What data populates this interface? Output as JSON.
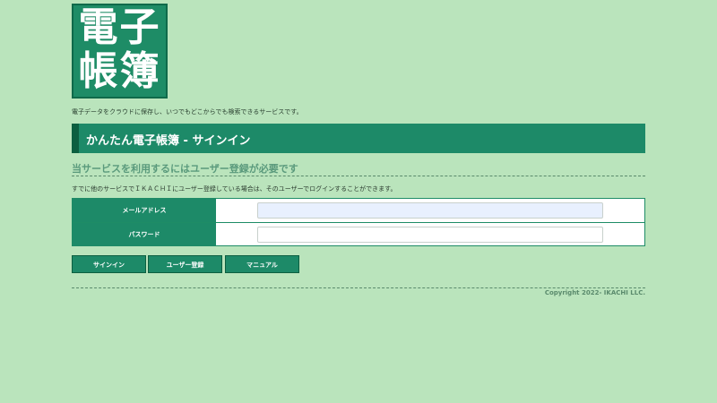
{
  "logo": {
    "line1": "電子",
    "line2": "帳簿"
  },
  "tagline": "電子データをクラウドに保存し、いつでもどこからでも検索できるサービスです。",
  "header": {
    "title": "かんたん電子帳簿 - サインイン"
  },
  "section": {
    "title": "当サービスを利用するにはユーザー登録が必要です",
    "info": "すでに他のサービスでＩＫＡＣＨＩにユーザー登録している場合は、そのユーザーでログインすることができます。"
  },
  "form": {
    "email_label": "メールアドレス",
    "email_value": "",
    "password_label": "パスワード",
    "password_value": ""
  },
  "buttons": {
    "signin": "サインイン",
    "register": "ユーザー登録",
    "manual": "マニュアル"
  },
  "footer": {
    "copyright": "Copyright 2022- IKACHI LLC."
  },
  "colors": {
    "background": "#bae4bc",
    "primary": "#1d8a68",
    "primary_dark": "#0c5f40"
  }
}
